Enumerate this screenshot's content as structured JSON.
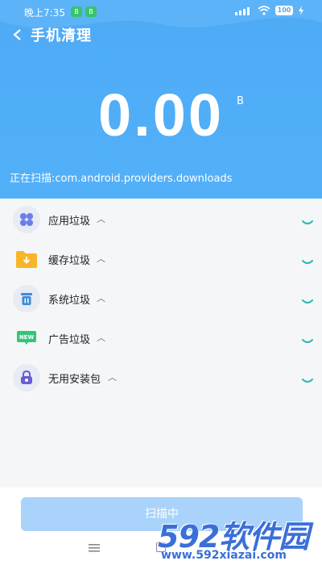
{
  "status_bar": {
    "time": "晚上7:35",
    "badge_1": "B",
    "badge_2": "B",
    "battery": "100"
  },
  "header": {
    "title": "手机清理",
    "size_value": "0.00",
    "size_unit": "B",
    "scan_path": "正在扫描:com.android.providers.downloads"
  },
  "junk_list": [
    {
      "label": "应用垃圾",
      "icon": "app-grid-icon"
    },
    {
      "label": "缓存垃圾",
      "icon": "folder-download-icon"
    },
    {
      "label": "系统垃圾",
      "icon": "trash-icon"
    },
    {
      "label": "广告垃圾",
      "icon": "new-badge-icon"
    },
    {
      "label": "无用安装包",
      "icon": "package-lock-icon"
    }
  ],
  "scan_button": {
    "label": "扫描中"
  },
  "watermark": {
    "main": "592软件园",
    "sub": "www.592xiazai.com"
  },
  "colors": {
    "header_blue": "#4eaaf6",
    "button_blue": "#a9d3fb",
    "spinner_teal": "#2bb8b0"
  }
}
